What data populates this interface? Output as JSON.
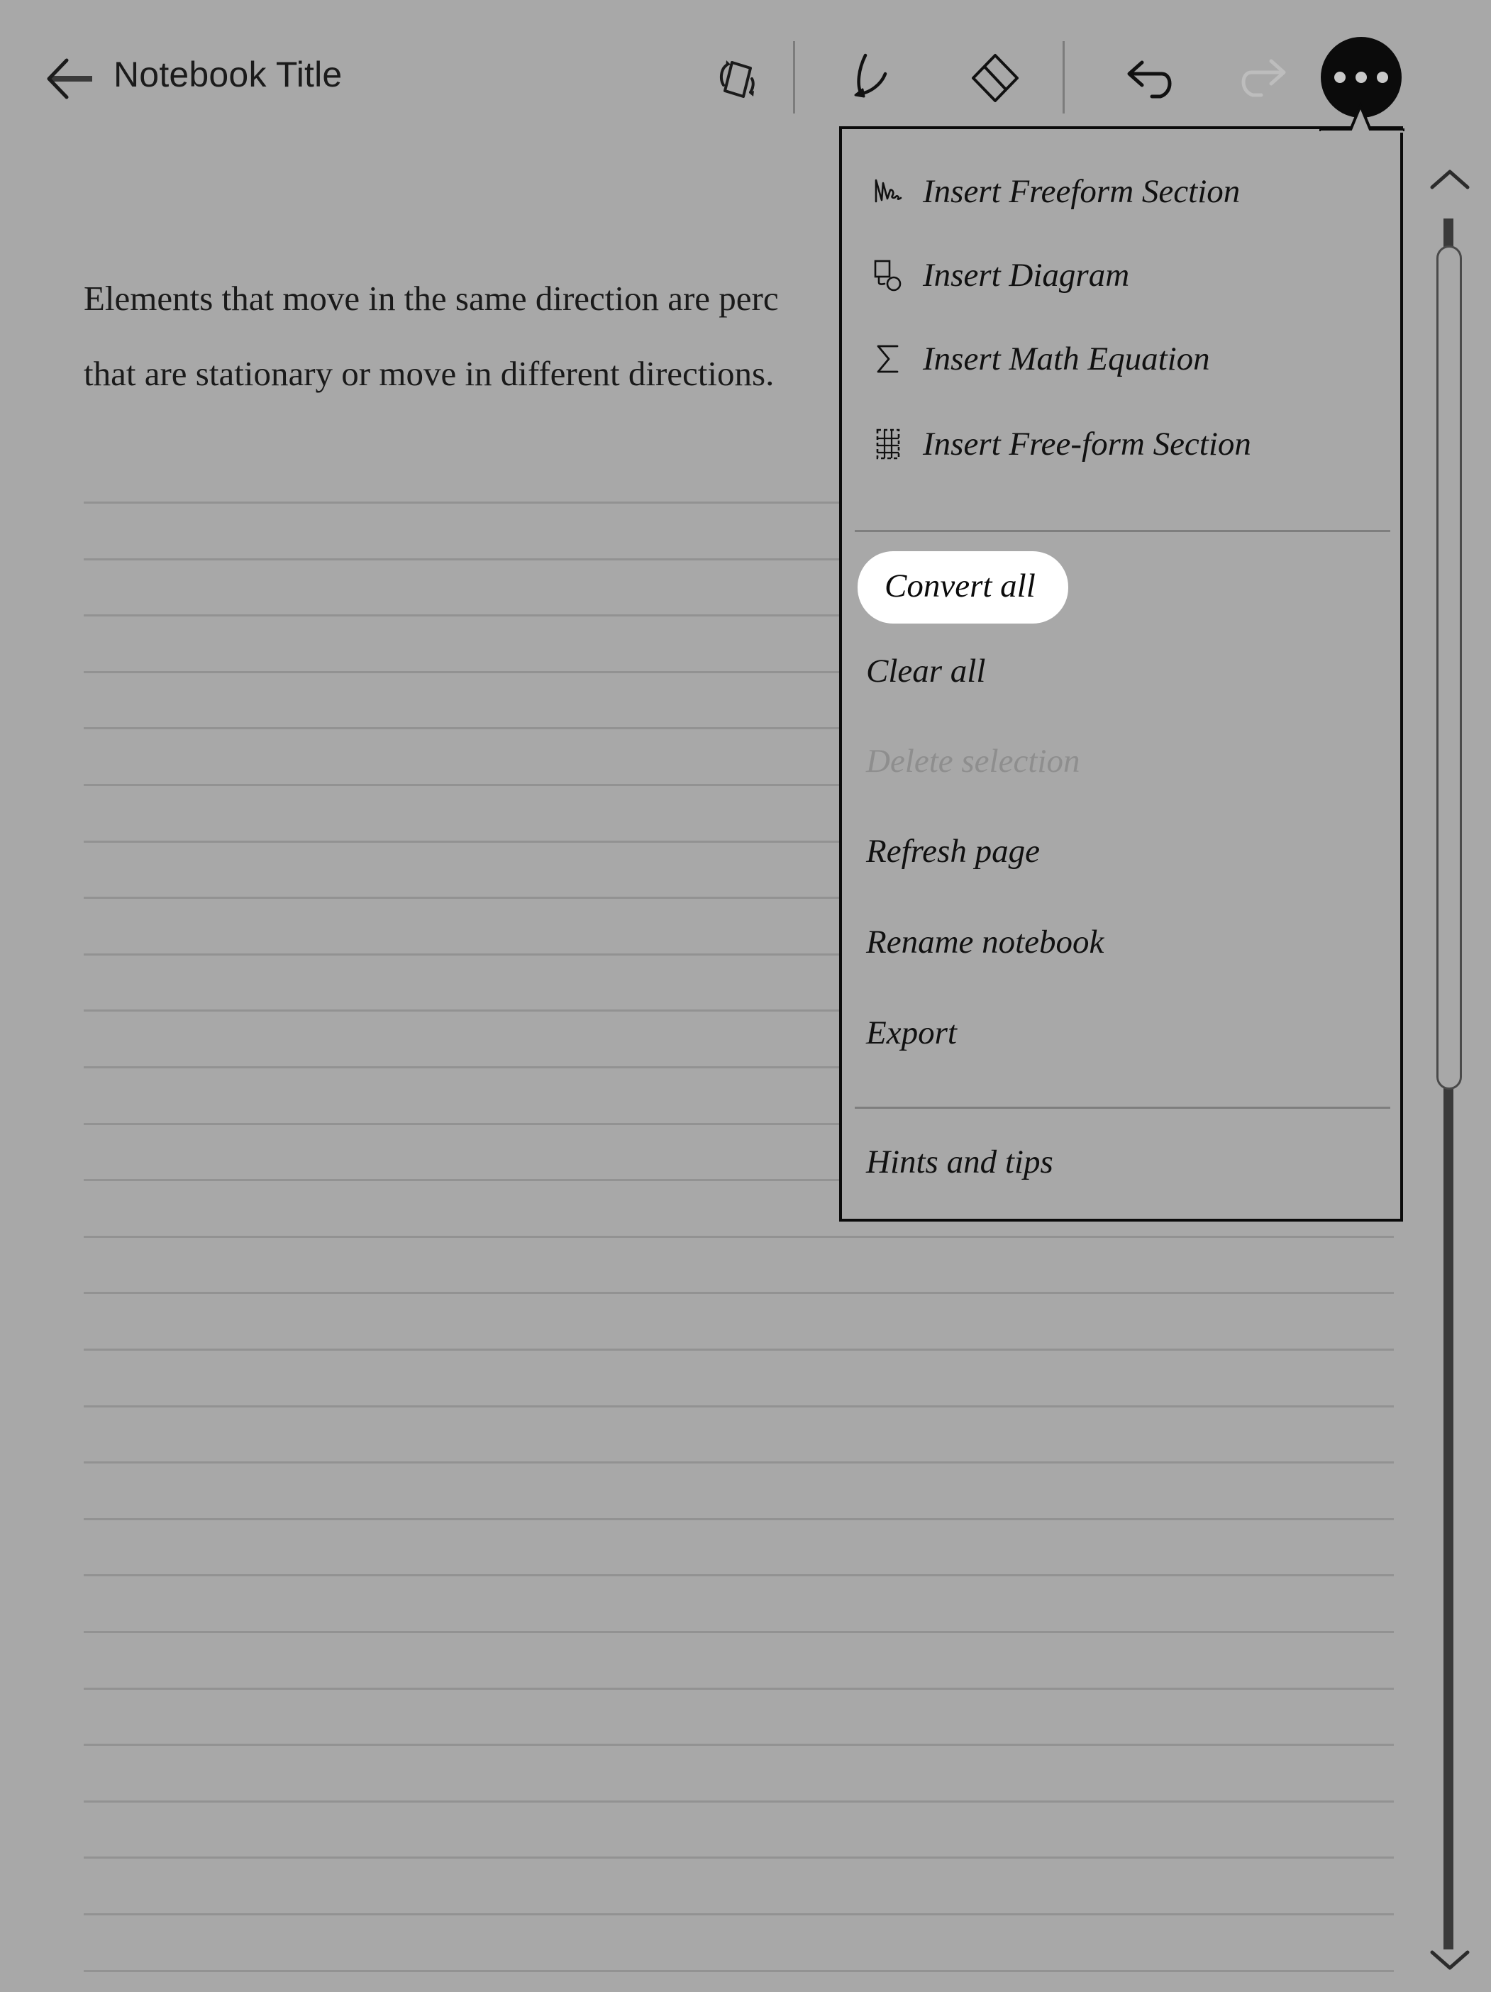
{
  "header": {
    "back_icon": "arrow-left-icon",
    "title": "Notebook Title",
    "tools": [
      {
        "name": "page-rotate-icon",
        "label": "Rotate page",
        "state": "enabled"
      },
      {
        "name": "pen-icon",
        "label": "Pen",
        "state": "enabled"
      },
      {
        "name": "eraser-icon",
        "label": "Eraser",
        "state": "enabled"
      },
      {
        "name": "undo-icon",
        "label": "Undo",
        "state": "enabled"
      },
      {
        "name": "redo-icon",
        "label": "Redo",
        "state": "disabled"
      }
    ],
    "more_button": {
      "name": "more-options-icon",
      "label": "More options",
      "dots": 3
    }
  },
  "page": {
    "body_text_line1": "Elements that move in the same direction are perc",
    "body_text_line2": "that are stationary or move in different directions.",
    "ruled_line_color": "#929292",
    "background_color": "#a8a8a8"
  },
  "scrollbar": {
    "up_icon": "chevron-up-icon",
    "down_icon": "chevron-down-icon",
    "thumb_label": "scroll-thumb"
  },
  "menu": {
    "groups": [
      {
        "items": [
          {
            "label": "Insert Freeform Section",
            "icon": "freeform-scribble-icon",
            "state": "enabled",
            "selected": false
          },
          {
            "label": "Insert Diagram",
            "icon": "diagram-icon",
            "state": "enabled",
            "selected": false
          },
          {
            "label": "Insert Math Equation",
            "icon": "sigma-icon",
            "state": "enabled",
            "selected": false
          },
          {
            "label": "Insert Free-form Section",
            "icon": "table-grid-icon",
            "state": "enabled",
            "selected": false
          }
        ]
      },
      {
        "items": [
          {
            "label": "Convert all",
            "icon": null,
            "state": "enabled",
            "selected": true
          },
          {
            "label": "Clear all",
            "icon": null,
            "state": "enabled",
            "selected": false
          },
          {
            "label": "Delete selection",
            "icon": null,
            "state": "disabled",
            "selected": false
          },
          {
            "label": "Refresh page",
            "icon": null,
            "state": "enabled",
            "selected": false
          },
          {
            "label": "Rename notebook",
            "icon": null,
            "state": "enabled",
            "selected": false
          },
          {
            "label": "Export",
            "icon": null,
            "state": "enabled",
            "selected": false
          }
        ]
      },
      {
        "items": [
          {
            "label": "Hints and tips",
            "icon": null,
            "state": "enabled",
            "selected": false
          }
        ]
      }
    ],
    "colors": {
      "border": "#0b0b0b",
      "background": "#a8a8a8",
      "selected_pill": "#ffffff",
      "disabled_text": "#8e8e8e",
      "separator": "#7e7e7e"
    }
  }
}
